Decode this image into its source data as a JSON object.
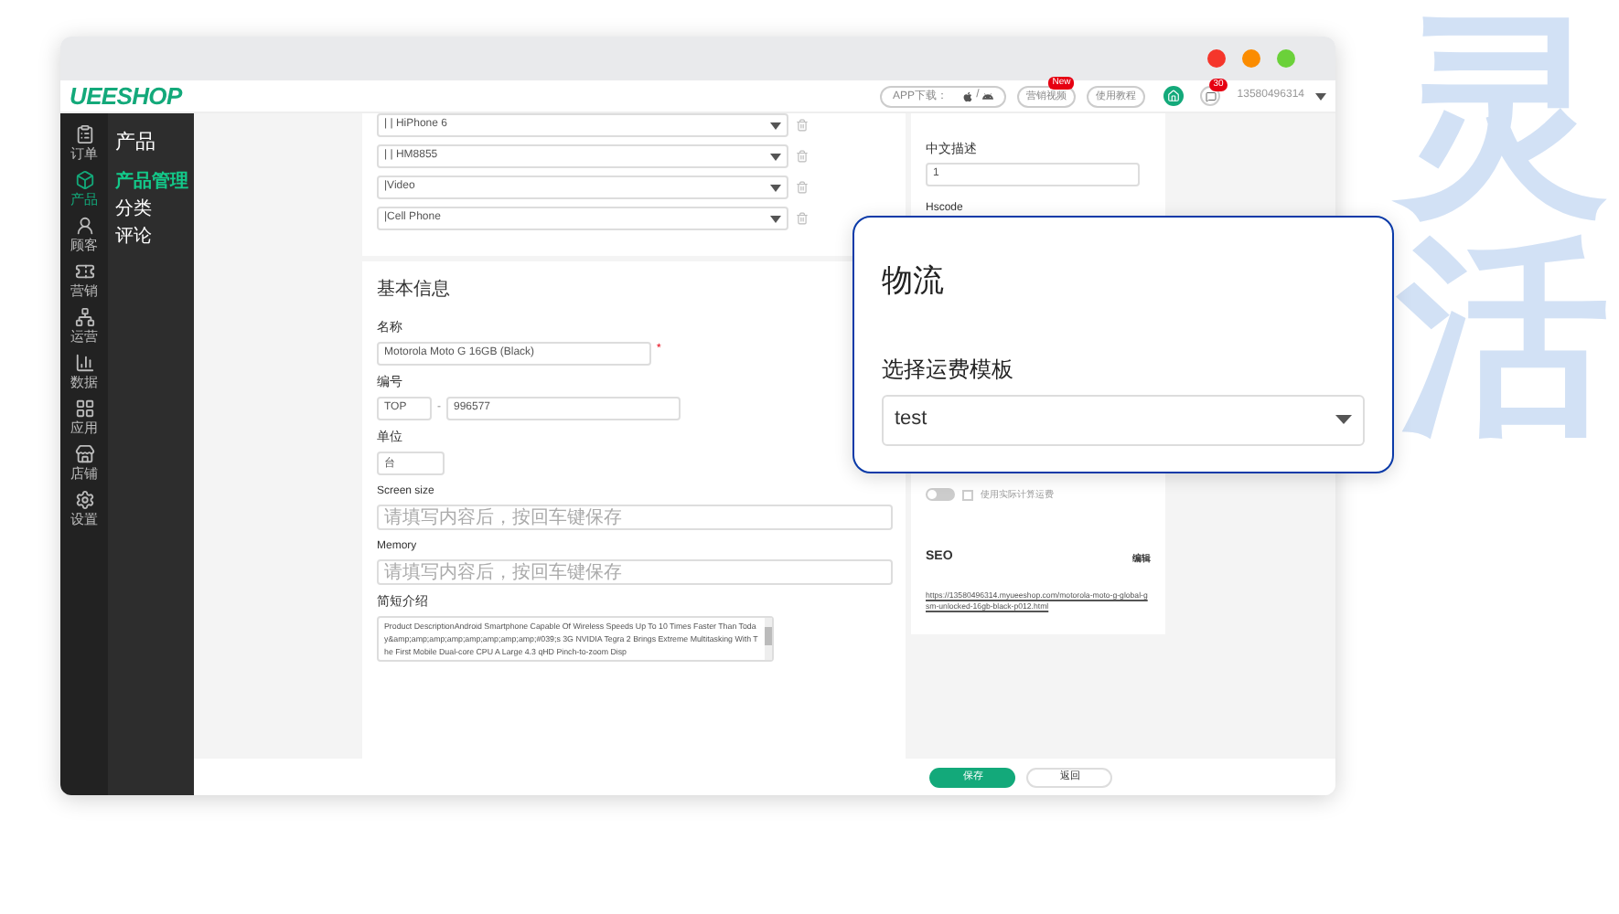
{
  "window": {
    "controls": [
      {
        "color": "#f5362b"
      },
      {
        "color": "#fb8c00"
      },
      {
        "color": "#6bd13a"
      }
    ]
  },
  "header": {
    "logo": "UEESHOP",
    "app_download": "APP下载：",
    "separator": "/",
    "links": [
      {
        "label": "营销视频",
        "badge": "New"
      },
      {
        "label": "使用教程"
      }
    ],
    "notification_badge": "30",
    "user": "13580496314"
  },
  "sidebar": {
    "items": [
      {
        "label": "订单",
        "selected": false
      },
      {
        "label": "产品",
        "selected": true
      },
      {
        "label": "顾客",
        "selected": false
      },
      {
        "label": "营销",
        "selected": false
      },
      {
        "label": "运营",
        "selected": false
      },
      {
        "label": "数据",
        "selected": false
      },
      {
        "label": "应用",
        "selected": false
      },
      {
        "label": "店铺",
        "selected": false
      },
      {
        "label": "设置",
        "selected": false
      }
    ]
  },
  "subnav": {
    "title": "产品",
    "items": [
      {
        "label": "产品管理",
        "selected": true
      },
      {
        "label": "分类",
        "selected": false
      },
      {
        "label": "评论",
        "selected": false
      }
    ]
  },
  "category_rows": [
    {
      "value": "| | HiPhone 6"
    },
    {
      "value": "| | HM8855"
    },
    {
      "value": "|Video"
    },
    {
      "value": "|Cell Phone"
    }
  ],
  "basic_info": {
    "title": "基本信息",
    "name": {
      "label": "名称",
      "value": "Motorola Moto G 16GB (Black)",
      "required_mark": "*"
    },
    "number": {
      "label": "编号",
      "prefix": "TOP",
      "separator": "-",
      "value": "996577"
    },
    "unit": {
      "label": "单位",
      "value": "台"
    },
    "attributes": [
      {
        "label": "Screen size",
        "placeholder": "请填写内容后，按回车键保存"
      },
      {
        "label": "Memory",
        "placeholder": "请填写内容后，按回车键保存"
      }
    ],
    "summary": {
      "label": "简短介绍",
      "value": "Product DescriptionAndroid Smartphone Capable Of Wireless Speeds Up To 10 Times Faster Than Today&amp;amp;amp;amp;amp;amp;amp;amp;#039;s 3G NVIDIA Tegra 2 Brings Extreme Multitasking With The First Mobile Dual-core CPU A Large 4.3 qHD Pinch-to-zoom Disp"
    }
  },
  "right_panel": {
    "description": {
      "label": "中文描述",
      "value": "1"
    },
    "hscode": {
      "label": "Hscode"
    },
    "toggle": {
      "on": false
    },
    "checkbox": {
      "label": "使用实际计算运费",
      "checked": false
    },
    "seo": {
      "title": "SEO",
      "edit": "编辑",
      "url": "https://13580496314.myueeshop.com/motorola-moto-g-global-gsm-unlocked-16gb-black-p012.html"
    }
  },
  "popup": {
    "title": "物流",
    "label": "选择运费模板",
    "value": "test"
  },
  "footer": {
    "buttons": [
      {
        "label": "保存",
        "kind": "primary"
      },
      {
        "label": "返回",
        "kind": "secondary"
      }
    ]
  },
  "decoration": {
    "text": "灵活"
  }
}
